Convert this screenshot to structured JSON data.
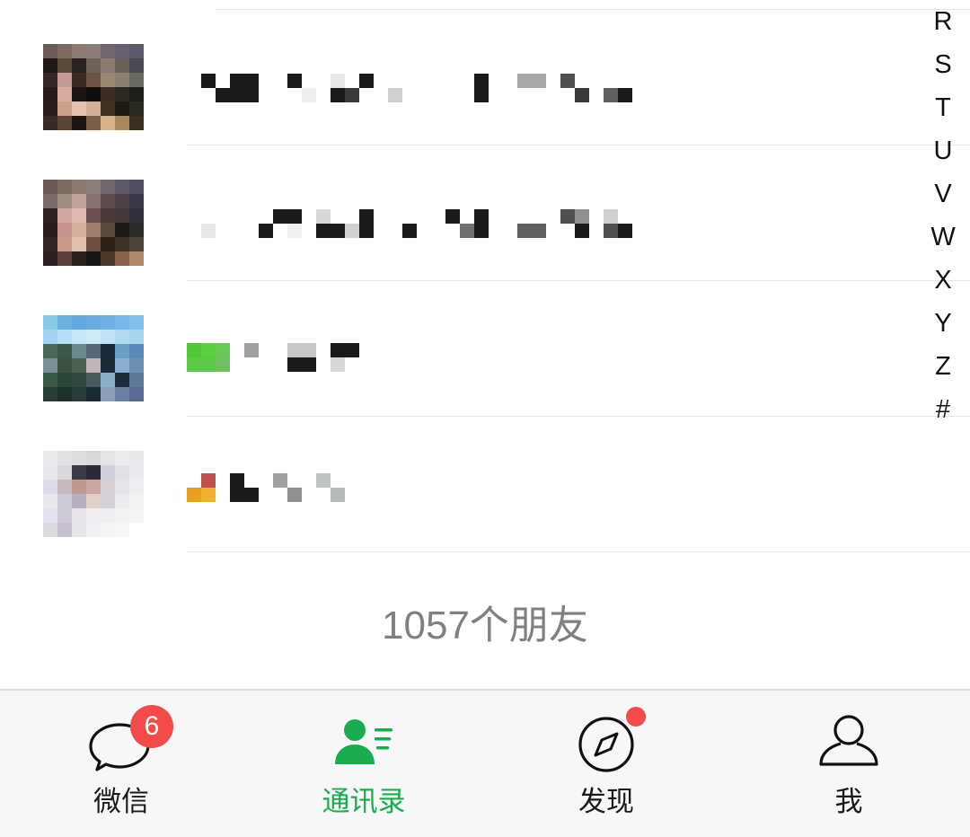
{
  "contacts": [
    {
      "name_mask": [
        [
          0,
          0,
          0,
          0,
          0,
          0,
          0,
          0,
          0,
          0,
          0,
          0,
          0,
          0,
          0,
          0,
          0,
          0,
          0,
          0,
          0,
          0,
          0,
          0,
          0,
          0,
          0,
          0,
          0,
          0,
          0
        ],
        [
          0,
          0,
          0,
          0,
          0,
          0,
          0,
          0,
          0,
          0,
          0,
          0,
          0,
          0,
          0,
          0,
          0,
          0,
          0,
          0,
          0,
          0,
          0,
          0,
          0,
          0,
          0,
          0,
          0,
          0,
          0
        ]
      ],
      "avatar": [
        "#6b5c58",
        "#7f6a62",
        "#8b7b72",
        "#8c7d7a",
        "#6f6670",
        "#666070",
        "#5a5a6a",
        "#1e1915",
        "#5b4a3a",
        "#2a2420",
        "#6d6257",
        "#8a7b72",
        "#6a6258",
        "#4a4b52",
        "#37272a",
        "#c49a95",
        "#3b2a22",
        "#6e5243",
        "#9a8870",
        "#8a8070",
        "#6a6a60",
        "#261a1a",
        "#d8aaa0",
        "#1a1512",
        "#0e0e0e",
        "#3d2c26",
        "#2b2820",
        "#1e1f1a",
        "#2a1e1d",
        "#c9a088",
        "#e8c0b0",
        "#d4b098",
        "#403020",
        "#1c1c12",
        "#2a2a20",
        "#3a2a25",
        "#5a4535",
        "#1a1510",
        "#7a6048",
        "#d9b48a",
        "#a8885a",
        "#3a3020"
      ]
    },
    {
      "avatar": [
        "#6a5a55",
        "#7a6a62",
        "#8a7a72",
        "#8d7f7a",
        "#6f6670",
        "#5f5868",
        "#525060",
        "#7a6a68",
        "#a08a82",
        "#c0a49c",
        "#867070",
        "#5c4c4c",
        "#4a4048",
        "#3a3848",
        "#2e2020",
        "#d4a8a0",
        "#e0b8b0",
        "#6a5050",
        "#4a3a38",
        "#423a3a",
        "#323038",
        "#281c1c",
        "#c8948a",
        "#d8b0a0",
        "#a07e70",
        "#5a4a40",
        "#1e1a18",
        "#2a2a2a",
        "#302424",
        "#c89a88",
        "#e4c0ae",
        "#6a4e3e",
        "#2a2018",
        "#3a3228",
        "#4a4438",
        "#2a1e1e",
        "#5a4038",
        "#2a201c",
        "#1a1412",
        "#4a3828",
        "#8a6048",
        "#b08868"
      ]
    },
    {
      "avatar": [
        "#8ac8e8",
        "#6ab0e0",
        "#64a8e0",
        "#6aaae0",
        "#70b0e4",
        "#78b8e8",
        "#84c0ec",
        "#a0d4f0",
        "#b8e0f4",
        "#c4e8f8",
        "#cceaf8",
        "#c0e4f6",
        "#b0daf2",
        "#a8d4f0",
        "#4a6858",
        "#3a5848",
        "#6a8890",
        "#586878",
        "#1a2a3a",
        "#6aa0c8",
        "#5a8ab8",
        "#7a9098",
        "#3a5040",
        "#4a6050",
        "#c0b8b8",
        "#1a2a38",
        "#8ab0d0",
        "#6a90b0",
        "#3a5a48",
        "#2a4838",
        "#2e4a40",
        "#485a5a",
        "#88b0c8",
        "#1c2c3c",
        "#5a7a98",
        "#2a3a34",
        "#1e3028",
        "#2a3a38",
        "#1a2a30",
        "#8aa0b8",
        "#6a80a0",
        "#5a6a90"
      ]
    },
    {
      "avatar": [
        "#e8eaef",
        "#e0e2e8",
        "#dcdde2",
        "#d8d8de",
        "#e4e4ea",
        "#ececf0",
        "#e8e8ee",
        "#e6e8ee",
        "#d8d8de",
        "#3a3a48",
        "#2a2a38",
        "#d0d0d8",
        "#e0e0e6",
        "#eaeaef",
        "#dcdce4",
        "#c8b8c0",
        "#c09890",
        "#c8a8a0",
        "#d8d0d8",
        "#e4e4ea",
        "#eeeef2",
        "#e8e8ee",
        "#cccad4",
        "#b8b0c0",
        "#e0d0c8",
        "#d8d0d8",
        "#ececf0",
        "#f2f2f4",
        "#e4e2ea",
        "#d0c8d4",
        "#e8e4ea",
        "#f0eef2",
        "#eeeef2",
        "#f2f2f4",
        "#f4f4f6",
        "#e0d8e0",
        "#c8c0d0",
        "#e8e4ec",
        "#f2f0f4",
        "#f4f4f6",
        "#f6f6f8",
        "#ffffff"
      ]
    }
  ],
  "index_letters": [
    "R",
    "S",
    "T",
    "U",
    "V",
    "W",
    "X",
    "Y",
    "Z",
    "#"
  ],
  "friend_count": "1057个朋友",
  "tabs": [
    {
      "label": "微信",
      "badge": "6"
    },
    {
      "label": "通讯录"
    },
    {
      "label": "发现"
    },
    {
      "label": "我"
    }
  ],
  "colors": {
    "accent_green": "#1aad4f",
    "badge_red": "#f34a4a",
    "tab_text": "#1a1a1a",
    "count_text": "#808080"
  }
}
